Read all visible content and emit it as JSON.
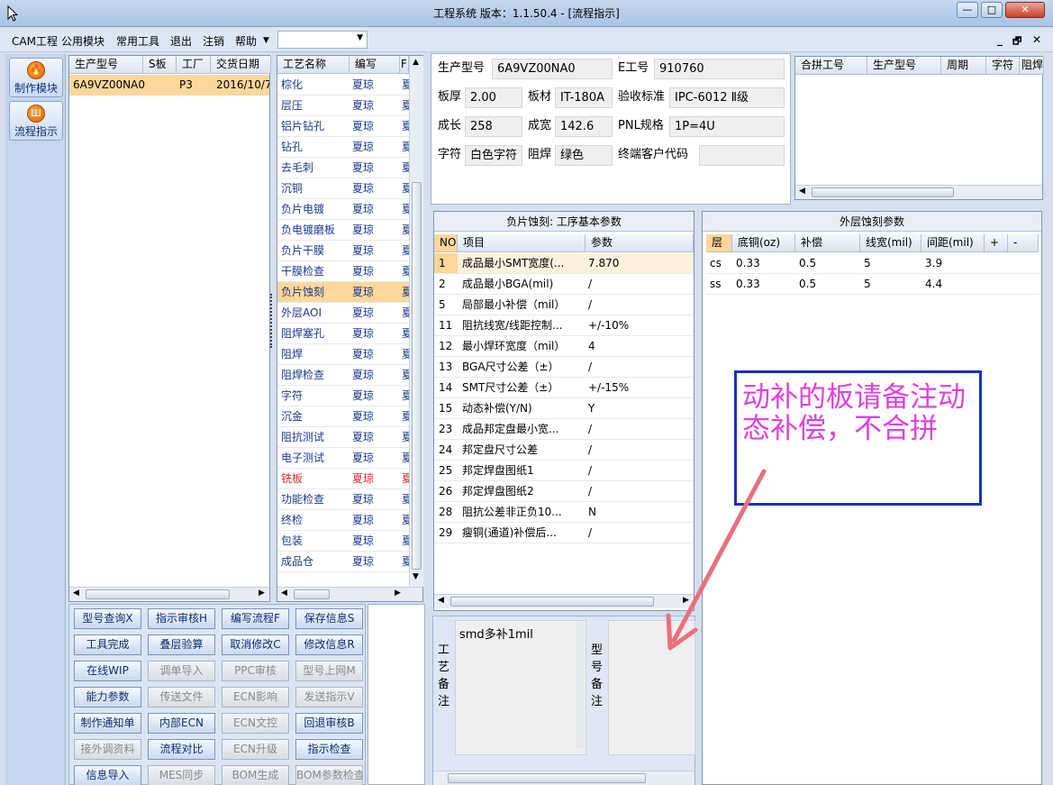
{
  "window": {
    "title": "工程系统  版本：1.1.50.4 - [流程指示]",
    "min": "—",
    "max": "□",
    "close": "✕"
  },
  "menu": {
    "items": [
      "CAM工程",
      "公用模块",
      "常用工具",
      "退出",
      "注销",
      "帮助"
    ],
    "combo_value": "",
    "combo_arrow": "▼",
    "mdi": [
      "_",
      "🗗",
      "✕"
    ]
  },
  "leftbar": {
    "make": "制作模块",
    "flow": "流程指示",
    "make_icon": "🔥",
    "flow_icon": "Ш"
  },
  "orders": {
    "headers": [
      "生产型号",
      "S板",
      "工厂",
      "交货日期"
    ],
    "rows": [
      {
        "model": "6A9VZ00NA0",
        "s": "",
        "factory": "P3",
        "date": "2016/10/7"
      }
    ]
  },
  "process": {
    "headers": [
      "工艺名称",
      "编写",
      "F"
    ],
    "rows": [
      {
        "name": "棕化",
        "writer": "夏琼",
        "x": "夏"
      },
      {
        "name": "层压",
        "writer": "夏琼",
        "x": "夏"
      },
      {
        "name": "铝片钻孔",
        "writer": "夏琼",
        "x": "夏"
      },
      {
        "name": "钻孔",
        "writer": "夏琼",
        "x": "夏"
      },
      {
        "name": "去毛刺",
        "writer": "夏琼",
        "x": "夏"
      },
      {
        "name": "沉铜",
        "writer": "夏琼",
        "x": "夏"
      },
      {
        "name": "负片电镀",
        "writer": "夏琼",
        "x": "夏"
      },
      {
        "name": "负电镀磨板",
        "writer": "夏琼",
        "x": "夏"
      },
      {
        "name": "负片干膜",
        "writer": "夏琼",
        "x": "夏"
      },
      {
        "name": "干膜检查",
        "writer": "夏琼",
        "x": "夏"
      },
      {
        "name": "负片蚀刻",
        "writer": "夏琼",
        "x": "夏"
      },
      {
        "name": "外层AOI",
        "writer": "夏琼",
        "x": "夏"
      },
      {
        "name": "阻焊塞孔",
        "writer": "夏琼",
        "x": "夏"
      },
      {
        "name": "阻焊",
        "writer": "夏琼",
        "x": "夏"
      },
      {
        "name": "阻焊检查",
        "writer": "夏琼",
        "x": "夏"
      },
      {
        "name": "字符",
        "writer": "夏琼",
        "x": "夏"
      },
      {
        "name": "沉金",
        "writer": "夏琼",
        "x": "夏"
      },
      {
        "name": "阻抗测试",
        "writer": "夏琼",
        "x": "夏"
      },
      {
        "name": "电子测试",
        "writer": "夏琼",
        "x": "夏"
      },
      {
        "name": "铣板",
        "writer": "夏琼",
        "x": "夏"
      },
      {
        "name": "功能检查",
        "writer": "夏琼",
        "x": "夏"
      },
      {
        "name": "终检",
        "writer": "夏琼",
        "x": "夏"
      },
      {
        "name": "包装",
        "writer": "夏琼",
        "x": "夏"
      },
      {
        "name": "成品仓",
        "writer": "夏琼",
        "x": "夏"
      }
    ],
    "selected_index": 10,
    "red_index": 19
  },
  "buttons": [
    {
      "label": "型号查询X",
      "enabled": true
    },
    {
      "label": "指示审核H",
      "enabled": true
    },
    {
      "label": "编写流程F",
      "enabled": true
    },
    {
      "label": "保存信息S",
      "enabled": true
    },
    {
      "label": "工具完成",
      "enabled": true
    },
    {
      "label": "叠层验算",
      "enabled": true
    },
    {
      "label": "取消修改C",
      "enabled": true
    },
    {
      "label": "修改信息R",
      "enabled": true
    },
    {
      "label": "在线WIP",
      "enabled": true
    },
    {
      "label": "调单导入",
      "enabled": false
    },
    {
      "label": "PPC审核",
      "enabled": false
    },
    {
      "label": "型号上网M",
      "enabled": false
    },
    {
      "label": "能力参数",
      "enabled": true
    },
    {
      "label": "传送文件",
      "enabled": false
    },
    {
      "label": "ECN影响",
      "enabled": false
    },
    {
      "label": "发送指示V",
      "enabled": false
    },
    {
      "label": "制作通知单",
      "enabled": true
    },
    {
      "label": "内部ECN",
      "enabled": true
    },
    {
      "label": "ECN文控",
      "enabled": false
    },
    {
      "label": "回退审核B",
      "enabled": true
    },
    {
      "label": "接外调资料",
      "enabled": false
    },
    {
      "label": "流程对比",
      "enabled": true
    },
    {
      "label": "ECN升级",
      "enabled": false
    },
    {
      "label": "指示检查",
      "enabled": true
    },
    {
      "label": "信息导入",
      "enabled": true
    },
    {
      "label": "MES同步",
      "enabled": false
    },
    {
      "label": "BOM生成",
      "enabled": false
    },
    {
      "label": "BOM参数检查",
      "enabled": false
    }
  ],
  "info": {
    "model_label": "生产型号",
    "model": "6A9VZ00NA0",
    "e_label": "E工号",
    "e_no": "910760",
    "thick_label": "板厚",
    "thick": "2.00",
    "mat_label": "板材",
    "mat": "IT-180A",
    "std_label": "验收标准",
    "std": "IPC-6012 Ⅱ级",
    "len_label": "成长",
    "len": "258",
    "wid_label": "成宽",
    "wid": "142.6",
    "pnl_label": "PNL规格",
    "pnl": "1P=4U",
    "char_label": "字符",
    "char": "白色字符",
    "mask_label": "阻焊",
    "mask": "绿色",
    "cust_label": "终端客户代码",
    "cust": ""
  },
  "merge": {
    "headers": [
      "合拼工号",
      "生产型号",
      "周期",
      "字符",
      "阻焊"
    ]
  },
  "etch": {
    "title": "负片蚀刻: 工序基本参数",
    "headers": [
      "NO",
      "项目",
      "参数"
    ],
    "rows": [
      {
        "no": "1",
        "item": "成品最小SMT宽度(...",
        "val": "7.870"
      },
      {
        "no": "2",
        "item": "成品最小BGA(mil)",
        "val": "/"
      },
      {
        "no": "5",
        "item": "局部最小补偿（mil）",
        "val": "/"
      },
      {
        "no": "11",
        "item": "阻抗线宽/线距控制...",
        "val": "+/-10%"
      },
      {
        "no": "12",
        "item": "最小焊环宽度（mil）",
        "val": "4"
      },
      {
        "no": "13",
        "item": "BGA尺寸公差（±）",
        "val": "/"
      },
      {
        "no": "14",
        "item": "SMT尺寸公差（±）",
        "val": "+/-15%"
      },
      {
        "no": "15",
        "item": "动态补偿(Y/N)",
        "val": "Y"
      },
      {
        "no": "23",
        "item": "成品邦定盘最小宽...",
        "val": "/"
      },
      {
        "no": "24",
        "item": "邦定盘尺寸公差",
        "val": "/"
      },
      {
        "no": "25",
        "item": "邦定焊盘图纸1",
        "val": "/"
      },
      {
        "no": "26",
        "item": "邦定焊盘图纸2",
        "val": "/"
      },
      {
        "no": "28",
        "item": "阻抗公差非正负10...",
        "val": "N"
      },
      {
        "no": "29",
        "item": "瘦铜(通道)补偿后...",
        "val": "/"
      }
    ]
  },
  "outer": {
    "title": "外层蚀刻参数",
    "headers": [
      "层",
      "底铜(oz)",
      "补偿",
      "线宽(mil)",
      "间距(mil)",
      "+",
      "-"
    ],
    "rows": [
      {
        "layer": "cs",
        "cu": "0.33",
        "comp": "0.5",
        "w": "5",
        "s": "3.9"
      },
      {
        "layer": "ss",
        "cu": "0.33",
        "comp": "0.5",
        "w": "5",
        "s": "4.4"
      }
    ]
  },
  "remarks": {
    "process_label": "工艺备注",
    "process_note": "smd多补1mil",
    "model_label": "型号备注",
    "model_note": ""
  },
  "annotation": {
    "text": "动补的板请备注动态补偿，不合拼",
    "color": "#e040e0",
    "arrow_color": "#e8707c"
  }
}
